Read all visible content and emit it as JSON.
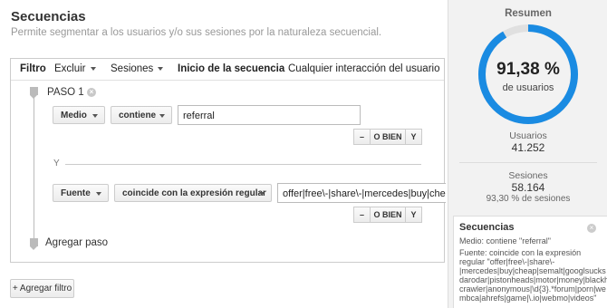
{
  "header": {
    "title": "Secuencias",
    "subtitle": "Permite segmentar a los usuarios y/o sus sesiones por la naturaleza secuencial."
  },
  "filter_bar": {
    "label": "Filtro",
    "exclude": "Excluir",
    "scope": "Sesiones",
    "sequence_start_label": "Inicio de la secuencia",
    "sequence_start_value": "Cualquier interacción del usuario"
  },
  "step1": {
    "label": "PASO 1",
    "condition1": {
      "dimension": "Medio",
      "operator": "contiene",
      "value": "referral"
    },
    "y_separator": "Y",
    "condition2": {
      "dimension": "Fuente",
      "operator": "coincide con la expresión regular",
      "value": "offer|free\\-|share\\-|mercedes|buy|cheap|"
    },
    "buttons": {
      "minus": "–",
      "or": "O BIEN",
      "and": "Y"
    }
  },
  "add_step_label": "Agregar paso",
  "add_filter_label": "+ Agregar filtro",
  "summary": {
    "title": "Resumen",
    "percent": "91,38 %",
    "percent_value": 0.9138,
    "percent_sub": "de usuarios",
    "users_label": "Usuarios",
    "users_value": "41.252",
    "sessions_label": "Sesiones",
    "sessions_value": "58.164",
    "sessions_pct": "93,30 % de sesiones",
    "ring_color": "#1a8be2",
    "ring_track_color": "#e0e0e0"
  },
  "tooltip": {
    "title": "Secuencias",
    "lines": [
      "Medio: contiene \"referral\"",
      "Fuente: coincide con la expresión",
      "regular \"offer|free\\-|share\\-",
      "|mercedes|buy|cheap|semalt|googlsucks",
      "darodar|pistonheads|motor|money|blackh",
      "crawler|anonymous|\\d{3}.*forum|porn|we",
      "mbca|ahrefs|game|\\.io|webmo|videos\""
    ]
  }
}
